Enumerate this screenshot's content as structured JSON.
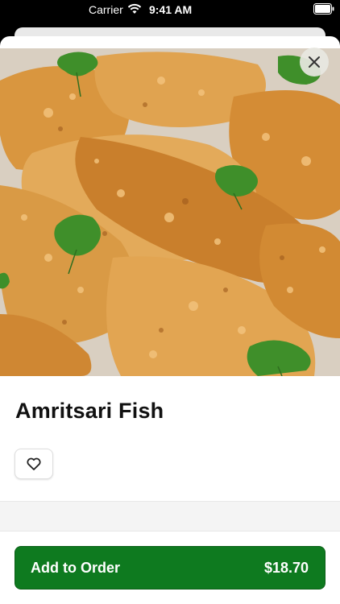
{
  "status_bar": {
    "carrier": "Carrier",
    "time": "9:41 AM",
    "wifi_icon": "wifi-icon",
    "battery_icon": "battery-icon"
  },
  "item": {
    "name": "Amritsari Fish",
    "image_alt": "fried fish pieces garnished with cilantro"
  },
  "actions": {
    "close_icon": "close-icon",
    "favorite_icon": "heart-outline-icon",
    "add_to_order_label": "Add to Order",
    "price": "$18.70"
  },
  "colors": {
    "accent": "#0e7a1f",
    "background": "#ffffff"
  }
}
